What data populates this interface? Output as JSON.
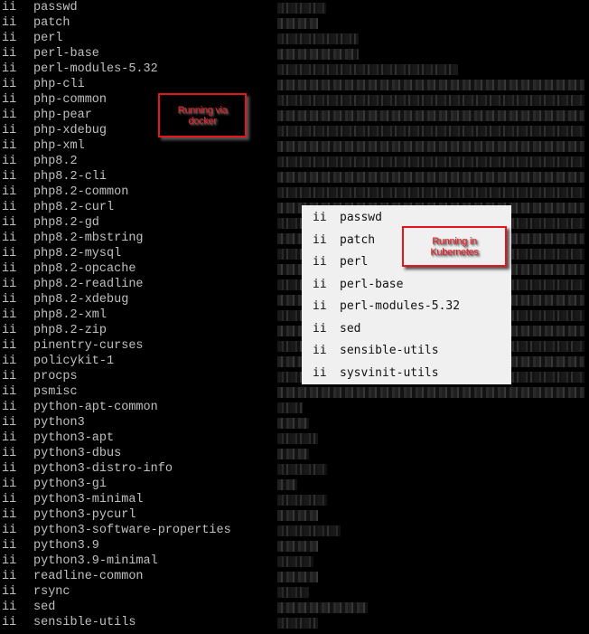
{
  "terminal": {
    "status_flag": "ii",
    "packages": [
      "passwd",
      "patch",
      "perl",
      "perl-base",
      "perl-modules-5.32",
      "php-cli",
      "php-common",
      "php-pear",
      "php-xdebug",
      "php-xml",
      "php8.2",
      "php8.2-cli",
      "php8.2-common",
      "php8.2-curl",
      "php8.2-gd",
      "php8.2-mbstring",
      "php8.2-mysql",
      "php8.2-opcache",
      "php8.2-readline",
      "php8.2-xdebug",
      "php8.2-xml",
      "php8.2-zip",
      "pinentry-curses",
      "policykit-1",
      "procps",
      "psmisc",
      "python-apt-common",
      "python3",
      "python3-apt",
      "python3-dbus",
      "python3-distro-info",
      "python3-gi",
      "python3-minimal",
      "python3-pycurl",
      "python3-software-properties",
      "python3.9",
      "python3.9-minimal",
      "readline-common",
      "rsync",
      "sed",
      "sensible-utils"
    ],
    "versions_redacted": true
  },
  "annotations": {
    "docker_label": "Running via docker",
    "kubernetes_label": "Running in Kubernetes",
    "border_color": "#e8141a"
  },
  "kubernetes_popup": {
    "status_flag": "ii",
    "packages": [
      "passwd",
      "patch",
      "perl",
      "perl-base",
      "perl-modules-5.32",
      "sed",
      "sensible-utils",
      "sysvinit-utils"
    ]
  }
}
